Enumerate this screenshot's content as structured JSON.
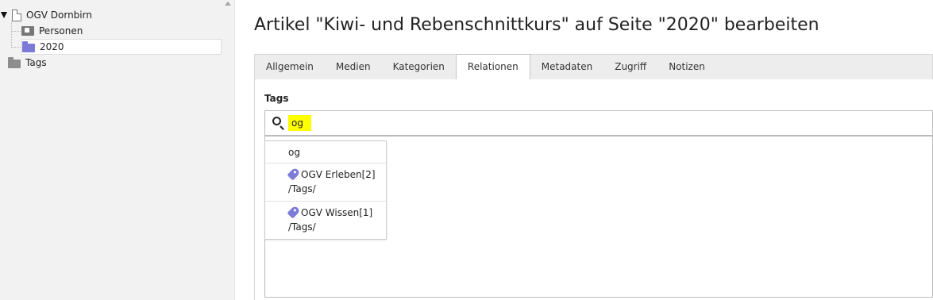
{
  "tree": {
    "root": {
      "label": "OGV Dornbirn"
    },
    "children": [
      {
        "label": "Personen",
        "icon": "sysfolder-icon"
      },
      {
        "label": "2020",
        "icon": "folder-icon",
        "selected": true
      }
    ],
    "sibling": {
      "label": "Tags",
      "icon": "folder-icon"
    }
  },
  "header": {
    "title": "Artikel \"Kiwi- und Rebenschnittkurs\" auf Seite \"2020\" bearbeiten"
  },
  "tabs": [
    {
      "label": "Allgemein"
    },
    {
      "label": "Medien"
    },
    {
      "label": "Kategorien"
    },
    {
      "label": "Relationen",
      "active": true
    },
    {
      "label": "Metadaten"
    },
    {
      "label": "Zugriff"
    },
    {
      "label": "Notizen"
    }
  ],
  "tags_field": {
    "label": "Tags",
    "search_value": "og",
    "highlight_color": "#ffff00",
    "suggestions": [
      {
        "title": "og"
      },
      {
        "title": "OGV Erleben[2]",
        "path": "/Tags/",
        "icon": "tag-icon"
      },
      {
        "title": "OGV Wissen[1]",
        "path": "/Tags/",
        "icon": "tag-icon"
      }
    ]
  },
  "colors": {
    "folder_accent": "#7c7cd8",
    "tab_bar": "#ededed"
  }
}
